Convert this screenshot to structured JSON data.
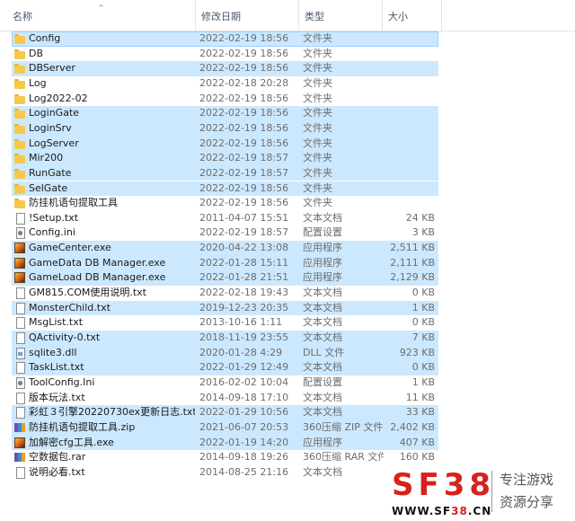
{
  "columns": {
    "name": "名称",
    "date": "修改日期",
    "type": "类型",
    "size": "大小"
  },
  "sort_indicator": "^",
  "files": [
    {
      "name": "Config",
      "date": "2022-02-19 18:56",
      "type": "文件夹",
      "size": "",
      "icon": "folder-icon",
      "selected": true,
      "focused": true
    },
    {
      "name": "DB",
      "date": "2022-02-19 18:56",
      "type": "文件夹",
      "size": "",
      "icon": "folder-icon",
      "selected": false
    },
    {
      "name": "DBServer",
      "date": "2022-02-19 18:56",
      "type": "文件夹",
      "size": "",
      "icon": "folder-icon",
      "selected": true
    },
    {
      "name": "Log",
      "date": "2022-02-18 20:28",
      "type": "文件夹",
      "size": "",
      "icon": "folder-icon",
      "selected": false
    },
    {
      "name": "Log2022-02",
      "date": "2022-02-19 18:56",
      "type": "文件夹",
      "size": "",
      "icon": "folder-icon",
      "selected": false
    },
    {
      "name": "LoginGate",
      "date": "2022-02-19 18:56",
      "type": "文件夹",
      "size": "",
      "icon": "folder-icon",
      "selected": true
    },
    {
      "name": "LoginSrv",
      "date": "2022-02-19 18:56",
      "type": "文件夹",
      "size": "",
      "icon": "folder-icon",
      "selected": true
    },
    {
      "name": "LogServer",
      "date": "2022-02-19 18:56",
      "type": "文件夹",
      "size": "",
      "icon": "folder-icon",
      "selected": true
    },
    {
      "name": "Mir200",
      "date": "2022-02-19 18:57",
      "type": "文件夹",
      "size": "",
      "icon": "folder-icon",
      "selected": true
    },
    {
      "name": "RunGate",
      "date": "2022-02-19 18:57",
      "type": "文件夹",
      "size": "",
      "icon": "folder-icon",
      "selected": true
    },
    {
      "name": "SelGate",
      "date": "2022-02-19 18:56",
      "type": "文件夹",
      "size": "",
      "icon": "folder-icon",
      "selected": true
    },
    {
      "name": "防挂机语句提取工具",
      "date": "2022-02-19 18:56",
      "type": "文件夹",
      "size": "",
      "icon": "folder-icon",
      "selected": false
    },
    {
      "name": "!Setup.txt",
      "date": "2011-04-07 15:51",
      "type": "文本文档",
      "size": "24 KB",
      "icon": "text-file-icon",
      "selected": false
    },
    {
      "name": "Config.ini",
      "date": "2022-02-19 18:57",
      "type": "配置设置",
      "size": "3 KB",
      "icon": "settings-file-icon",
      "selected": false
    },
    {
      "name": "GameCenter.exe",
      "date": "2020-04-22 13:08",
      "type": "应用程序",
      "size": "2,511 KB",
      "icon": "app-icon",
      "selected": true
    },
    {
      "name": "GameData DB Manager.exe",
      "date": "2022-01-28 15:11",
      "type": "应用程序",
      "size": "2,111 KB",
      "icon": "app-icon",
      "selected": true
    },
    {
      "name": "GameLoad DB Manager.exe",
      "date": "2022-01-28 21:51",
      "type": "应用程序",
      "size": "2,129 KB",
      "icon": "app-icon",
      "selected": true
    },
    {
      "name": "GM815.COM使用说明.txt",
      "date": "2022-02-18 19:43",
      "type": "文本文档",
      "size": "0 KB",
      "icon": "text-file-icon",
      "selected": false
    },
    {
      "name": "MonsterChild.txt",
      "date": "2019-12-23 20:35",
      "type": "文本文档",
      "size": "1 KB",
      "icon": "text-file-icon",
      "selected": true
    },
    {
      "name": "MsgList.txt",
      "date": "2013-10-16 1:11",
      "type": "文本文档",
      "size": "0 KB",
      "icon": "text-file-icon",
      "selected": false
    },
    {
      "name": "QActivity-0.txt",
      "date": "2018-11-19 23:55",
      "type": "文本文档",
      "size": "7 KB",
      "icon": "text-file-icon",
      "selected": true
    },
    {
      "name": "sqlite3.dll",
      "date": "2020-01-28 4:29",
      "type": "DLL 文件",
      "size": "923 KB",
      "icon": "dll-file-icon",
      "selected": true
    },
    {
      "name": "TaskList.txt",
      "date": "2022-01-29 12:49",
      "type": "文本文档",
      "size": "0 KB",
      "icon": "text-file-icon",
      "selected": true
    },
    {
      "name": "ToolConfig.Ini",
      "date": "2016-02-02 10:04",
      "type": "配置设置",
      "size": "1 KB",
      "icon": "settings-file-icon",
      "selected": false
    },
    {
      "name": "版本玩法.txt",
      "date": "2014-09-18 17:10",
      "type": "文本文档",
      "size": "11 KB",
      "icon": "text-file-icon",
      "selected": false
    },
    {
      "name": "彩虹３引擎20220730ex更新日志.txt",
      "date": "2022-01-29 10:56",
      "type": "文本文档",
      "size": "33 KB",
      "icon": "text-file-icon",
      "selected": true
    },
    {
      "name": "防挂机语句提取工具.zip",
      "date": "2021-06-07 20:53",
      "type": "360压缩 ZIP 文件",
      "size": "2,402 KB",
      "icon": "archive-icon",
      "selected": true
    },
    {
      "name": "加解密cfg工具.exe",
      "date": "2022-01-19 14:20",
      "type": "应用程序",
      "size": "407 KB",
      "icon": "app-icon",
      "selected": true
    },
    {
      "name": "空数据包.rar",
      "date": "2014-09-18 19:26",
      "type": "360压缩 RAR 文件",
      "size": "160 KB",
      "icon": "archive-icon",
      "selected": false
    },
    {
      "name": "说明必看.txt",
      "date": "2014-08-25 21:16",
      "type": "文本文档",
      "size": "",
      "icon": "text-file-icon",
      "selected": false
    }
  ],
  "watermark": {
    "logo": "SF38",
    "url_prefix": "WWW.SF",
    "url_accent": "38",
    "url_suffix": ".CN",
    "tagline_1": "专注游戏",
    "tagline_2": "资源分享",
    "accent_color": "#d8201c"
  },
  "colors": {
    "selection": "#cce8ff",
    "selection_border": "#99d1ff",
    "header_text": "#4c5a6e"
  }
}
